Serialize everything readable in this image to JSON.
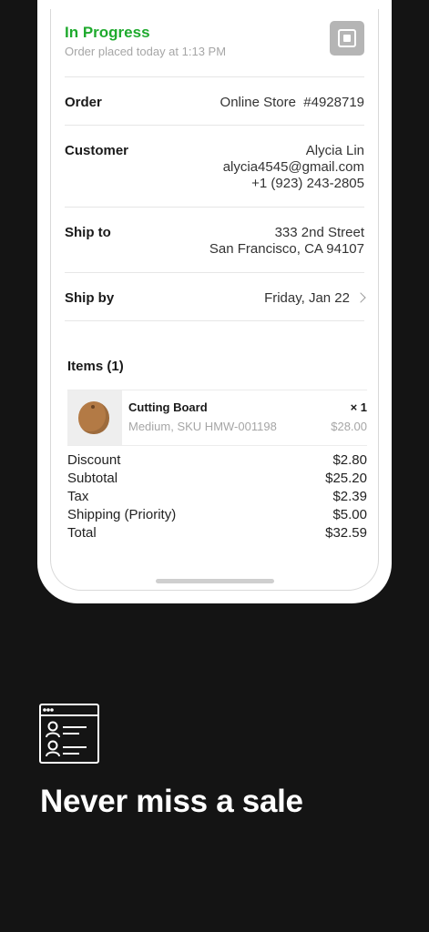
{
  "order_card": {
    "status": "In Progress",
    "placed": "Order placed today at 1:13 PM",
    "order": {
      "label": "Order",
      "value": "Online Store  #4928719"
    },
    "customer": {
      "label": "Customer",
      "name": "Alycia Lin",
      "email": "alycia4545@gmail.com",
      "phone": "+1 (923) 243-2805"
    },
    "ship_to": {
      "label": "Ship to",
      "line1": "333 2nd Street",
      "line2": "San Francisco, CA 94107"
    },
    "ship_by": {
      "label": "Ship by",
      "value": "Friday, Jan 22"
    },
    "items_title": "Items (1)",
    "items": [
      {
        "name": "Cutting Board",
        "detail": "Medium, SKU HMW-001198",
        "qty": "× 1",
        "price": "$28.00"
      }
    ],
    "totals": [
      {
        "label": "Discount",
        "value": "$2.80"
      },
      {
        "label": "Subtotal",
        "value": "$25.20"
      },
      {
        "label": "Tax",
        "value": "$2.39"
      },
      {
        "label": "Shipping (Priority)",
        "value": "$5.00"
      },
      {
        "label": "Total",
        "value": "$32.59"
      }
    ]
  },
  "promo": {
    "icon": "customer-list-icon",
    "headline": "Never miss a sale"
  },
  "colors": {
    "status_green": "#1faa2e",
    "background": "#141414"
  }
}
